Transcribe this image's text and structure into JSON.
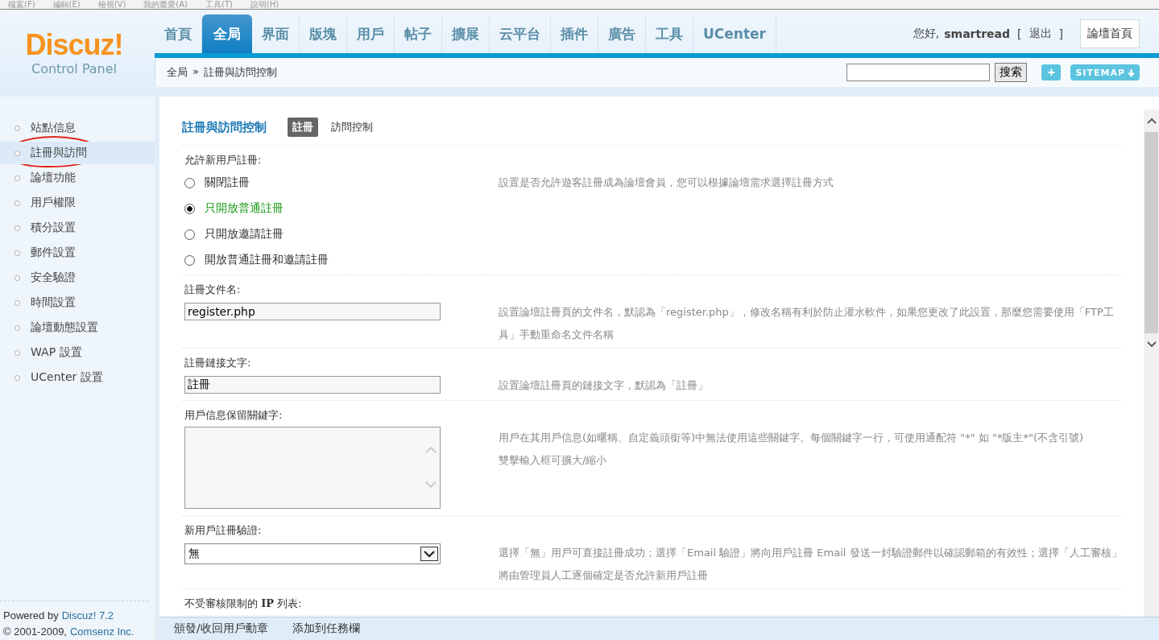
{
  "browser_menu": [
    "檔案(F)",
    "編輯(E)",
    "檢視(V)",
    "我的最愛(A)",
    "工具(T)",
    "說明(H)"
  ],
  "logo": {
    "name": "Discuz!",
    "subtitle": "Control Panel"
  },
  "nav": [
    {
      "label": "首頁",
      "selected": false
    },
    {
      "label": "全局",
      "selected": true
    },
    {
      "label": "界面",
      "selected": false
    },
    {
      "label": "版塊",
      "selected": false
    },
    {
      "label": "用戶",
      "selected": false
    },
    {
      "label": "帖子",
      "selected": false
    },
    {
      "label": "擴展",
      "selected": false
    },
    {
      "label": "云平台",
      "selected": false
    },
    {
      "label": "插件",
      "selected": false
    },
    {
      "label": "廣告",
      "selected": false
    },
    {
      "label": "工具",
      "selected": false
    },
    {
      "label": "UCenter",
      "selected": false
    }
  ],
  "user": {
    "greeting": "您好,",
    "username": "smartread",
    "bracket_open": "[",
    "logout": "退出",
    "bracket_close": "]",
    "home_button": "論壇首頁"
  },
  "breadcrumb": {
    "parent": "全局",
    "separator": "»",
    "current": "註冊與訪問控制"
  },
  "search": {
    "button": "搜索"
  },
  "add_button": "+",
  "sitemap_button": "SITEMAP",
  "sidebar": {
    "items": [
      {
        "label": "站點信息",
        "selected": false,
        "circled": false
      },
      {
        "label": "註冊與訪問",
        "selected": true,
        "circled": true
      },
      {
        "label": "論壇功能",
        "selected": false,
        "circled": false
      },
      {
        "label": "用戶權限",
        "selected": false,
        "circled": false
      },
      {
        "label": "積分設置",
        "selected": false,
        "circled": false
      },
      {
        "label": "郵件設置",
        "selected": false,
        "circled": false
      },
      {
        "label": "安全驗證",
        "selected": false,
        "circled": false
      },
      {
        "label": "時間設置",
        "selected": false,
        "circled": false
      },
      {
        "label": "論壇動態設置",
        "selected": false,
        "circled": false
      },
      {
        "label": "WAP 設置",
        "selected": false,
        "circled": false
      },
      {
        "label": "UCenter 設置",
        "selected": false,
        "circled": false
      }
    ]
  },
  "content": {
    "title": "註冊與訪問控制",
    "tabs": [
      {
        "label": "註冊",
        "selected": true
      },
      {
        "label": "訪問控制",
        "selected": false
      }
    ],
    "settings": [
      {
        "kind": "radio",
        "label": "允許新用戶註冊:",
        "options": [
          {
            "label": "關閉註冊",
            "selected": false
          },
          {
            "label": "只開放普通註冊",
            "selected": true
          },
          {
            "label": "只開放邀請註冊",
            "selected": false
          },
          {
            "label": "開放普通註冊和邀請註冊",
            "selected": false
          }
        ],
        "description": [
          "設置是否允許遊客註冊成為論壇會員，您可以根據論壇需求選擇註冊方式"
        ]
      },
      {
        "kind": "text",
        "label": "註冊文件名:",
        "value": "register.php",
        "description": [
          "設置論壇註冊頁的文件名，默認為「register.php」，修改名稱有利於防止灌水軟件，如果您更改了此設置，那麼您需要使用「FTP工具」手動重命名文件名稱"
        ]
      },
      {
        "kind": "text",
        "label": "註冊鏈接文字:",
        "value": "註冊",
        "description": [
          "設置論壇註冊頁的鏈接文字，默認為「註冊」"
        ]
      },
      {
        "kind": "textarea",
        "label": "用戶信息保留關鍵字:",
        "description": [
          "用戶在其用戶信息(如暱稱、自定義頭銜等)中無法使用這些關鍵字。每個關鍵字一行，可使用通配符 \"*\" 如 \"*版主*\"(不含引號)",
          "雙擊輸入框可擴大/縮小"
        ]
      },
      {
        "kind": "select",
        "label": "新用戶註冊驗證:",
        "value": "無",
        "description": [
          "選擇「無」用戶可直接註冊成功；選擇「Email 驗證」將向用戶註冊 Email 發送一封驗證郵件以確認郵箱的有效性；選擇「人工審核」將由管理員人工逐個確定是否允許新用戶註冊"
        ]
      },
      {
        "kind": "label",
        "label": "不受審核限制的 **IP** 列表:"
      }
    ]
  },
  "footer": {
    "powered": "Powered by",
    "brand": "Discuz! 7.2",
    "copyright": "© 2001-2009,",
    "company": "Comsenz Inc."
  },
  "bottom_bar": [
    "頒發/收回用戶勳章",
    "添加到任務欄"
  ]
}
